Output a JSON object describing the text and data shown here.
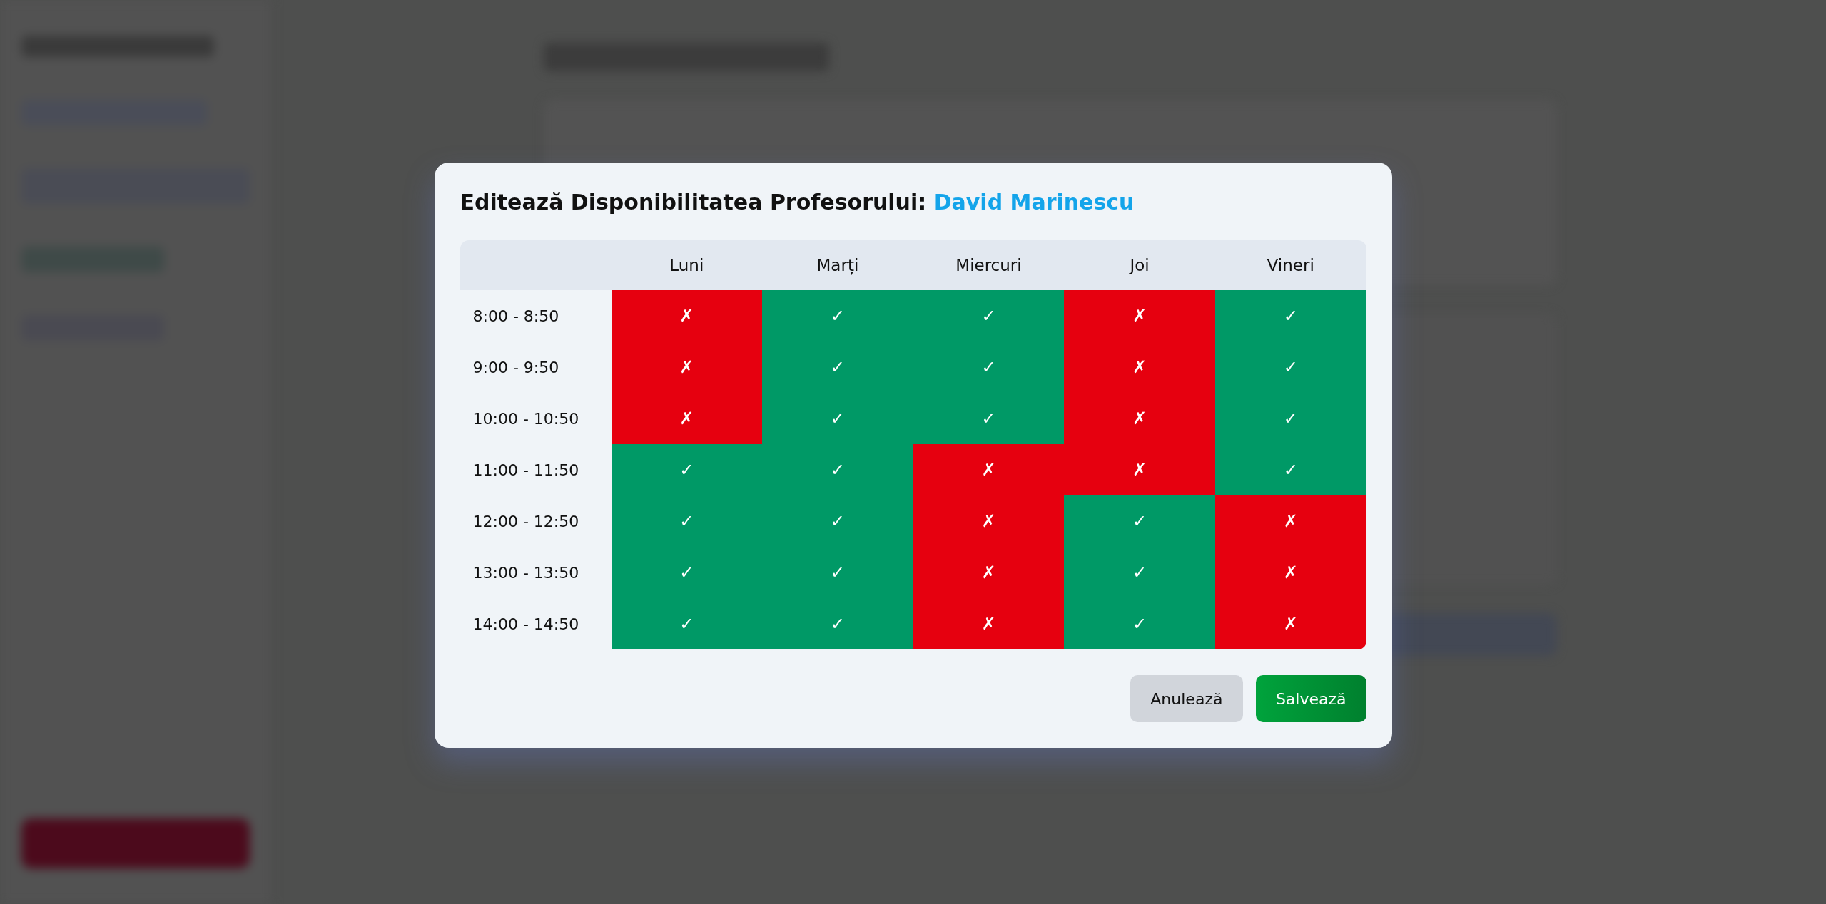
{
  "dialog": {
    "title": "Editează Disponibilitatea Profesorului:",
    "teacher": "David Marinescu",
    "days": [
      "Luni",
      "Marți",
      "Miercuri",
      "Joi",
      "Vineri"
    ],
    "rows": [
      {
        "time": "8:00 - 8:50",
        "cells": [
          {
            "mark": "✗",
            "available": false
          },
          {
            "mark": "✓",
            "available": true
          },
          {
            "mark": "✓",
            "available": true
          },
          {
            "mark": "✗",
            "available": false
          },
          {
            "mark": "✓",
            "available": true
          }
        ]
      },
      {
        "time": "9:00 - 9:50",
        "cells": [
          {
            "mark": "✗",
            "available": false
          },
          {
            "mark": "✓",
            "available": true
          },
          {
            "mark": "✓",
            "available": true
          },
          {
            "mark": "✗",
            "available": false
          },
          {
            "mark": "✓",
            "available": true
          }
        ]
      },
      {
        "time": "10:00 - 10:50",
        "cells": [
          {
            "mark": "✗",
            "available": false
          },
          {
            "mark": "✓",
            "available": true
          },
          {
            "mark": "✓",
            "available": true
          },
          {
            "mark": "✗",
            "available": false
          },
          {
            "mark": "✓",
            "available": true
          }
        ]
      },
      {
        "time": "11:00 - 11:50",
        "cells": [
          {
            "mark": "✓",
            "available": true
          },
          {
            "mark": "✓",
            "available": true
          },
          {
            "mark": "✗",
            "available": false
          },
          {
            "mark": "✗",
            "available": false
          },
          {
            "mark": "✓",
            "available": true
          }
        ]
      },
      {
        "time": "12:00 - 12:50",
        "cells": [
          {
            "mark": "✓",
            "available": true
          },
          {
            "mark": "✓",
            "available": true
          },
          {
            "mark": "✗",
            "available": false
          },
          {
            "mark": "✓",
            "available": true
          },
          {
            "mark": "✗",
            "available": false
          }
        ]
      },
      {
        "time": "13:00 - 13:50",
        "cells": [
          {
            "mark": "✓",
            "available": true
          },
          {
            "mark": "✓",
            "available": true
          },
          {
            "mark": "✗",
            "available": false
          },
          {
            "mark": "✓",
            "available": true
          },
          {
            "mark": "✗",
            "available": false
          }
        ]
      },
      {
        "time": "14:00 - 14:50",
        "cells": [
          {
            "mark": "✓",
            "available": true
          },
          {
            "mark": "✓",
            "available": true
          },
          {
            "mark": "✗",
            "available": false
          },
          {
            "mark": "✓",
            "available": true
          },
          {
            "mark": "✗",
            "available": false
          }
        ]
      }
    ],
    "buttons": [
      {
        "label": "Anulează",
        "kind": "cancel"
      },
      {
        "label": "Salvează",
        "kind": "save"
      }
    ]
  }
}
